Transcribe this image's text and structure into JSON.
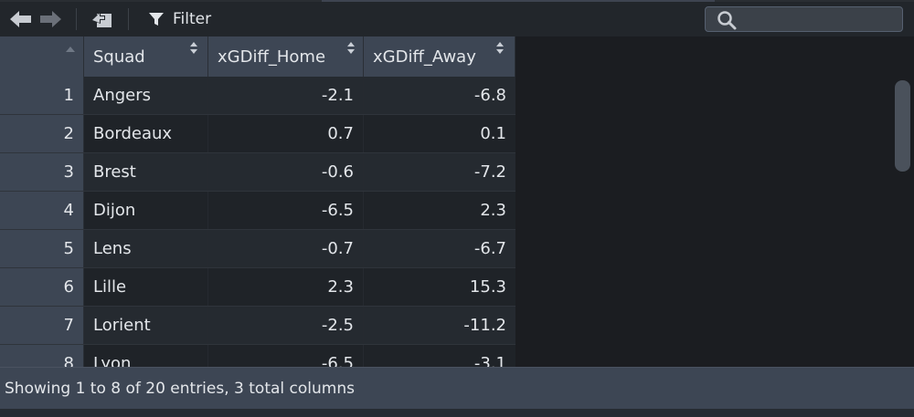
{
  "toolbar": {
    "filter_label": "Filter",
    "search": {
      "value": "",
      "placeholder": ""
    },
    "icons": [
      "back-arrow-icon",
      "forward-arrow-icon",
      "popout-icon",
      "filter-icon",
      "search-icon"
    ]
  },
  "table": {
    "columns": [
      "",
      "Squad",
      "xGDiff_Home",
      "xGDiff_Away"
    ],
    "rows": [
      {
        "idx": "1",
        "squad": "Angers",
        "home": "-2.1",
        "away": "-6.8"
      },
      {
        "idx": "2",
        "squad": "Bordeaux",
        "home": "0.7",
        "away": "0.1"
      },
      {
        "idx": "3",
        "squad": "Brest",
        "home": "-0.6",
        "away": "-7.2"
      },
      {
        "idx": "4",
        "squad": "Dijon",
        "home": "-6.5",
        "away": "2.3"
      },
      {
        "idx": "5",
        "squad": "Lens",
        "home": "-0.7",
        "away": "-6.7"
      },
      {
        "idx": "6",
        "squad": "Lille",
        "home": "2.3",
        "away": "15.3"
      },
      {
        "idx": "7",
        "squad": "Lorient",
        "home": "-2.5",
        "away": "-11.2"
      },
      {
        "idx": "8",
        "squad": "Lyon",
        "home": "-6.5",
        "away": "-3.1"
      }
    ]
  },
  "status": {
    "text": "Showing 1 to 8 of 20 entries, 3 total columns"
  },
  "colors": {
    "header_bg": "#3d4654",
    "body_bg": "#1b1d21",
    "text": "#e3e6ea"
  }
}
